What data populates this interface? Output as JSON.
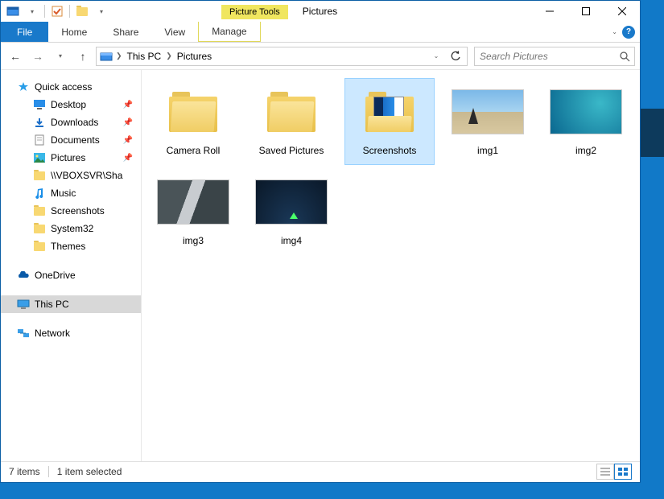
{
  "window": {
    "contextual_tab": "Picture Tools",
    "title": "Pictures"
  },
  "ribbon": {
    "file": "File",
    "tabs": [
      "Home",
      "Share",
      "View"
    ],
    "context_tab": "Manage"
  },
  "address": {
    "crumbs": [
      "This PC",
      "Pictures"
    ]
  },
  "search": {
    "placeholder": "Search Pictures"
  },
  "nav_pane": {
    "quick_access": "Quick access",
    "quick_items": [
      {
        "label": "Desktop",
        "icon": "desktop",
        "pinned": true
      },
      {
        "label": "Downloads",
        "icon": "downloads",
        "pinned": true
      },
      {
        "label": "Documents",
        "icon": "documents",
        "pinned": true
      },
      {
        "label": "Pictures",
        "icon": "pictures",
        "pinned": true
      },
      {
        "label": "\\\\VBOXSVR\\Shar",
        "icon": "folder",
        "pinned": false
      },
      {
        "label": "Music",
        "icon": "music",
        "pinned": false
      },
      {
        "label": "Screenshots",
        "icon": "folder",
        "pinned": false
      },
      {
        "label": "System32",
        "icon": "folder",
        "pinned": false
      },
      {
        "label": "Themes",
        "icon": "folder",
        "pinned": false
      }
    ],
    "onedrive": "OneDrive",
    "this_pc": "This PC",
    "network": "Network"
  },
  "items": [
    {
      "label": "Camera Roll",
      "type": "folder",
      "selected": false
    },
    {
      "label": "Saved Pictures",
      "type": "folder",
      "selected": false
    },
    {
      "label": "Screenshots",
      "type": "folder-screenshots",
      "selected": true
    },
    {
      "label": "img1",
      "type": "img1",
      "selected": false
    },
    {
      "label": "img2",
      "type": "img2",
      "selected": false
    },
    {
      "label": "img3",
      "type": "img3",
      "selected": false
    },
    {
      "label": "img4",
      "type": "img4",
      "selected": false
    }
  ],
  "status": {
    "count": "7 items",
    "selection": "1 item selected"
  }
}
